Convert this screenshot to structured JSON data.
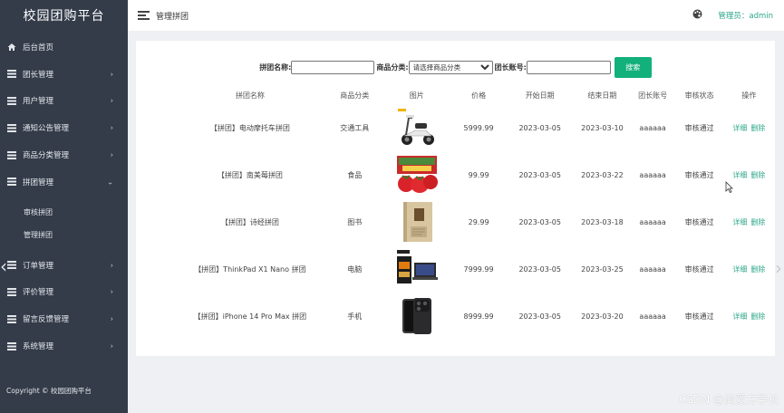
{
  "sidebar": {
    "brand": "校园团购平台",
    "items": [
      {
        "label": "后台首页",
        "icon": "home-icon",
        "has_arrow": false
      },
      {
        "label": "团长管理",
        "icon": "list-icon",
        "has_arrow": true
      },
      {
        "label": "用户管理",
        "icon": "list-icon",
        "has_arrow": true
      },
      {
        "label": "通知公告管理",
        "icon": "list-icon",
        "has_arrow": true
      },
      {
        "label": "商品分类管理",
        "icon": "list-icon",
        "has_arrow": true
      },
      {
        "label": "拼团管理",
        "icon": "list-icon",
        "has_arrow": true,
        "expanded": true
      }
    ],
    "submenu": [
      "审核拼团",
      "管理拼团"
    ],
    "items_after": [
      {
        "label": "订单管理"
      },
      {
        "label": "评价管理"
      },
      {
        "label": "留言反馈管理"
      },
      {
        "label": "系统管理"
      }
    ],
    "copyright": "Copyright © 校园团购平台"
  },
  "topbar": {
    "breadcrumb": "管理拼团",
    "admin": "管理员：admin"
  },
  "search": {
    "name_label": "拼团名称:",
    "category_label": "商品分类:",
    "category_selected": "请选择商品分类",
    "leader_label": "团长账号:",
    "button": "搜索"
  },
  "table": {
    "headers": [
      "拼团名称",
      "商品分类",
      "图片",
      "价格",
      "开始日期",
      "结束日期",
      "团长账号",
      "审核状态",
      "操作"
    ],
    "rows": [
      {
        "name": "【拼团】电动摩托车拼团",
        "category": "交通工具",
        "image": "scooter",
        "price": "5999.99",
        "start": "2023-03-05",
        "end": "2023-03-10",
        "leader": "aaaaaa",
        "status": "审核通过"
      },
      {
        "name": "【拼团】南美莓拼团",
        "category": "食品",
        "image": "strawberry",
        "price": "99.99",
        "start": "2023-03-05",
        "end": "2023-03-22",
        "leader": "aaaaaa",
        "status": "审核通过"
      },
      {
        "name": "【拼团】诗经拼团",
        "category": "图书",
        "image": "book",
        "price": "29.99",
        "start": "2023-03-05",
        "end": "2023-03-18",
        "leader": "aaaaaa",
        "status": "审核通过"
      },
      {
        "name": "【拼团】ThinkPad X1 Nano 拼团",
        "category": "电脑",
        "image": "laptop",
        "price": "7999.99",
        "start": "2023-03-05",
        "end": "2023-03-25",
        "leader": "aaaaaa",
        "status": "审核通过"
      },
      {
        "name": "【拼团】iPhone 14 Pro Max 拼团",
        "category": "手机",
        "image": "phone",
        "price": "8999.99",
        "start": "2023-03-05",
        "end": "2023-03-20",
        "leader": "aaaaaa",
        "status": "审核通过"
      }
    ],
    "action_detail": "详细",
    "action_delete": "删除"
  },
  "watermark": "CSDN @尚爱方学长",
  "colors": {
    "sidebar": "#343c4a",
    "accent": "#12b07a",
    "link": "#2ba68a"
  }
}
